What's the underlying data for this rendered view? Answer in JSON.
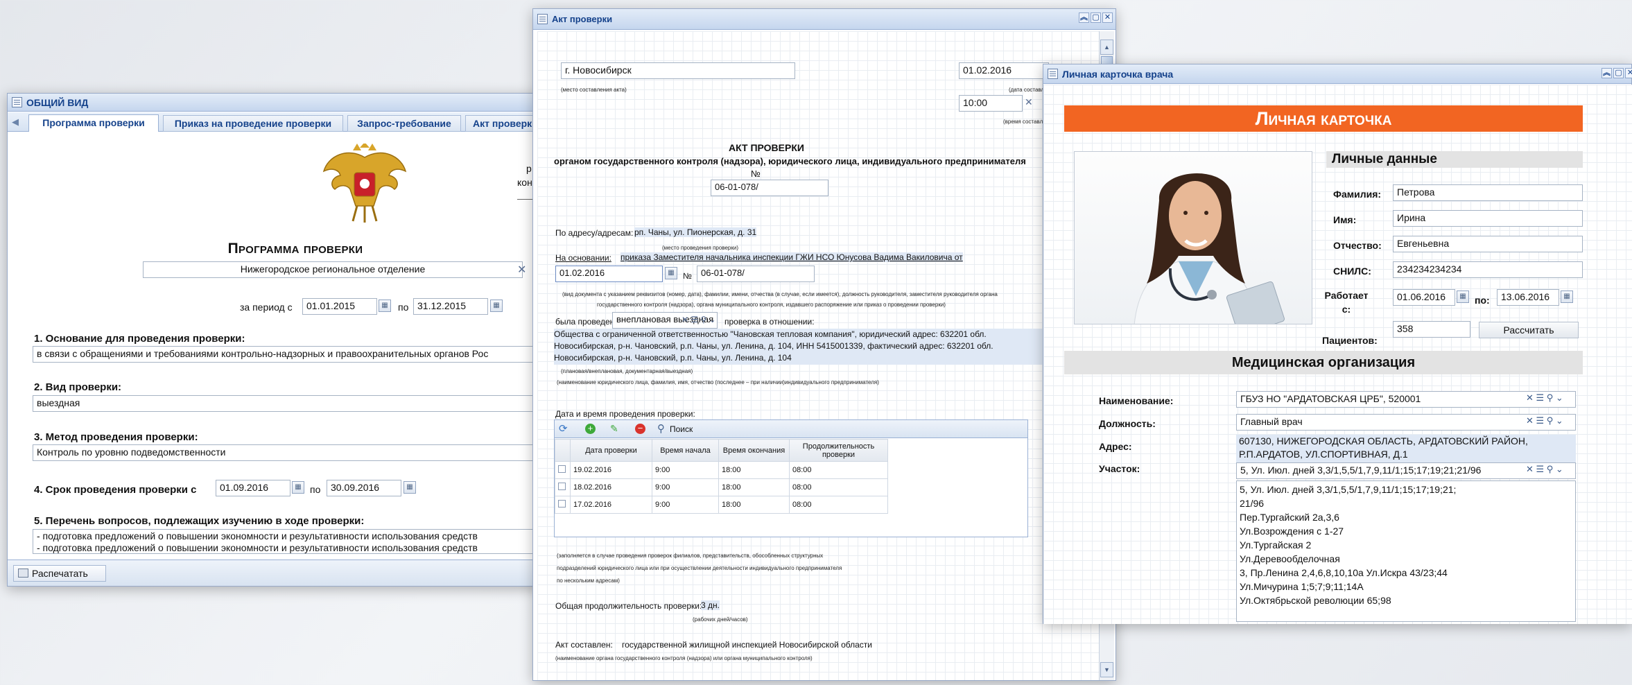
{
  "win1": {
    "title": "ОБЩИЙ ВИД",
    "tabs": [
      "Программа проверки",
      "Приказ на проведение проверки",
      "Запрос-требование",
      "Акт проверки"
    ],
    "doc_title": "Программа проверки",
    "org": "Нижегородское региональное отделение",
    "period_label": "за период с",
    "period_from": "01.01.2015",
    "po": "по",
    "period_to": "31.12.2015",
    "right_frag1": "р",
    "right_frag2": "кон",
    "s1_label": "1. Основание для проведения проверки:",
    "s1_value": "в связи с обращениями и требованиями контрольно-надзорных и правоохранительных органов Рос",
    "s2_label": "2. Вид проверки:",
    "s2_value": "выездная",
    "s3_label": "3. Метод проведения проверки:",
    "s3_value": "Контроль по уровню подведомственности",
    "s4_label": "4. Срок проведения проверки с",
    "s4_from": "01.09.2016",
    "s4_to": "30.09.2016",
    "s5_label": "5. Перечень вопросов, подлежащих изучению в ходе проверки:",
    "s5_line1": "- подготовка предложений о повышении экономности и результативности использования средств",
    "s5_line2": "- подготовка предложений о повышении экономности и результативности использования средств",
    "print_btn": "Распечатать"
  },
  "win2": {
    "title": "Акт проверки",
    "city": "г. Новосибирск",
    "city_cap": "(место составления акта)",
    "date": "01.02.2016",
    "date_cap": "(дата составления акта)",
    "time": "10:00",
    "time_cap": "(время составления акта)",
    "act_title": "АКТ ПРОВЕРКИ",
    "act_sub": "органом государственного контроля (надзора), юридического лица, индивидуального предпринимателя",
    "num_sign": "№",
    "num": "06-01-078/",
    "addr_label": "По адресу/адресам:",
    "addr": "рп. Чаны, ул. Пионерская, д. 31",
    "addr_cap": "(место проведения проверки)",
    "basis_label": "На основании:",
    "basis": "приказа Заместителя начальника инспекции ГЖИ НСО Юнусова Вадима Вакиловича от",
    "basis_date": "01.02.2016",
    "basis_num_sign": "№",
    "basis_num": "06-01-078/",
    "basis_cap1": "(вид документа с указанием реквизитов (номер, дата), фамилии, имени, отчества (в случае, если имеется), должность руководителя, заместителя руководителя органа",
    "basis_cap2": "государственного контроля (надзора), органа муниципального контроля, издавшего распоряжение или приказ о проведении проверки)",
    "held_label": "была проведена",
    "held": "внеплановая выездная",
    "held_after": "проверка в отношении:",
    "subject_l1": "Общества с ограниченной ответственностью \"Чановская тепловая компания\", юридический адрес: 632201 обл.",
    "subject_l2": "Новосибирская, р-н. Чановский, р.п. Чаны, ул. Ленина, д. 104, ИНН 5415001339, фактический адрес: 632201 обл.",
    "subject_l3": "Новосибирская, р-н. Чановский, р.п. Чаны, ул. Ленина, д. 104",
    "subject_cap1": "(плановая/внеплановая, документарная/выездная)",
    "subject_cap2": "(наименование юридического лица, фамилия, имя, отчество (последнее – при наличии)индивидуального предпринимателя)",
    "dt_label": "Дата и время проведения проверки:",
    "search": "Поиск",
    "cols": [
      "Дата проверки",
      "Время начала",
      "Время окончания",
      "Продолжительность проверки"
    ],
    "rows": [
      [
        "19.02.2016",
        "9:00",
        "18:00",
        "08:00"
      ],
      [
        "18.02.2016",
        "9:00",
        "18:00",
        "08:00"
      ],
      [
        "17.02.2016",
        "9:00",
        "18:00",
        "08:00"
      ]
    ],
    "note1": "(заполняется в случае проведения проверок филиалов, представительств, обособленных структурных",
    "note2": "подразделений юридического лица или при осуществлении деятельности индивидуального предпринимателя",
    "note3": "по нескольким адресам)",
    "dur_label": "Общая продолжительность проверки:",
    "dur": "3 дн.",
    "dur_cap": "(рабочих дней/часов)",
    "made_label": "Акт составлен:",
    "made": "государственной жилищной инспекцией Новосибирской области",
    "made_cap": "(наименование органа государственного контроля (надзора) или органа муниципального контроля)"
  },
  "win3": {
    "title": "Личная карточка врача",
    "banner": "Личная карточка",
    "personal": "Личные данные",
    "surname_label": "Фамилия:",
    "surname": "Петрова",
    "name_label": "Имя:",
    "name": "Ирина",
    "patr_label": "Отчество:",
    "patr": "Евгеньевна",
    "snils_label": "СНИЛС:",
    "snils": "234234234234",
    "works_label": "Работает с:",
    "works_from": "01.06.2016",
    "po": "по:",
    "works_to": "13.06.2016",
    "patients_label": "Пациентов:",
    "patients": "358",
    "calc_btn": "Рассчитать",
    "med_org": "Медицинская организация",
    "org_label": "Наименование:",
    "org": "ГБУЗ НО \"АРДАТОВСКАЯ ЦРБ\", 520001",
    "pos_label": "Должность:",
    "pos": "Главный врач",
    "addr_label": "Адрес:",
    "addr1": "607130, НИЖЕГОРОДСКАЯ ОБЛАСТЬ, АРДАТОВСКИЙ РАЙОН,",
    "addr2": "Р.П.АРДАТОВ, УЛ.СПОРТИВНАЯ, Д.1",
    "plot_label": "Участок:",
    "plot": "5, Ул. Июл. дней 3,3/1,5,5/1,7,9,11/1;15;17;19;21;21/96",
    "plot_list": [
      "5, Ул. Июл. дней 3,3/1,5,5/1,7,9,11/1;15;17;19;21;",
      "21/96",
      "Пер.Тургайский 2а,3,6",
      "Ул.Возрождения с 1-27",
      "Ул.Тургайская 2",
      "Ул.Деревообделочная",
      "3, Пр.Ленина 2,4,6,8,10,10а Ул.Искра 43/23;44",
      "Ул.Мичурина 1;5;7;9;11;14А",
      "Ул.Октябрьской революции 65;98"
    ]
  },
  "colors": {
    "banner": "#f26522",
    "title_text": "#15428b",
    "highlight": "#dfe8f5"
  }
}
